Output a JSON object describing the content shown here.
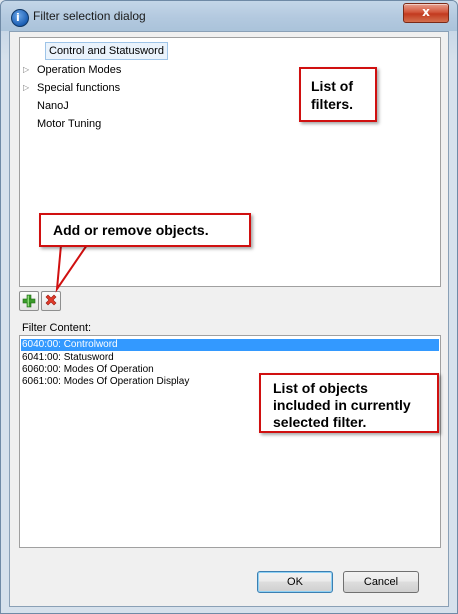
{
  "window": {
    "title": "Filter selection dialog",
    "close_glyph": "x"
  },
  "filter_tree": {
    "items": [
      {
        "label": "Control and Statusword",
        "expandable": false,
        "selected": true
      },
      {
        "label": "Operation Modes",
        "expandable": true,
        "selected": false
      },
      {
        "label": "Special functions",
        "expandable": true,
        "selected": false
      },
      {
        "label": "NanoJ",
        "expandable": false,
        "selected": false
      },
      {
        "label": "Motor Tuning",
        "expandable": false,
        "selected": false
      }
    ]
  },
  "toolbar": {
    "add_icon": "plus-icon",
    "remove_icon": "remove-x-icon"
  },
  "filter_content": {
    "label": "Filter Content:",
    "items": [
      {
        "text": "6040:00: Controlword",
        "selected": true
      },
      {
        "text": "6041:00: Statusword",
        "selected": false
      },
      {
        "text": "6060:00: Modes Of Operation",
        "selected": false
      },
      {
        "text": "6061:00: Modes Of Operation Display",
        "selected": false
      }
    ]
  },
  "buttons": {
    "ok": "OK",
    "cancel": "Cancel"
  },
  "callouts": {
    "list_of_filters": [
      "List of",
      "filters."
    ],
    "add_remove": "Add or remove objects.",
    "list_of_objects": [
      "List of objects",
      "included in currently",
      "selected filter."
    ]
  },
  "colors": {
    "selection": "#3399ff",
    "callout_border": "#d01010"
  }
}
